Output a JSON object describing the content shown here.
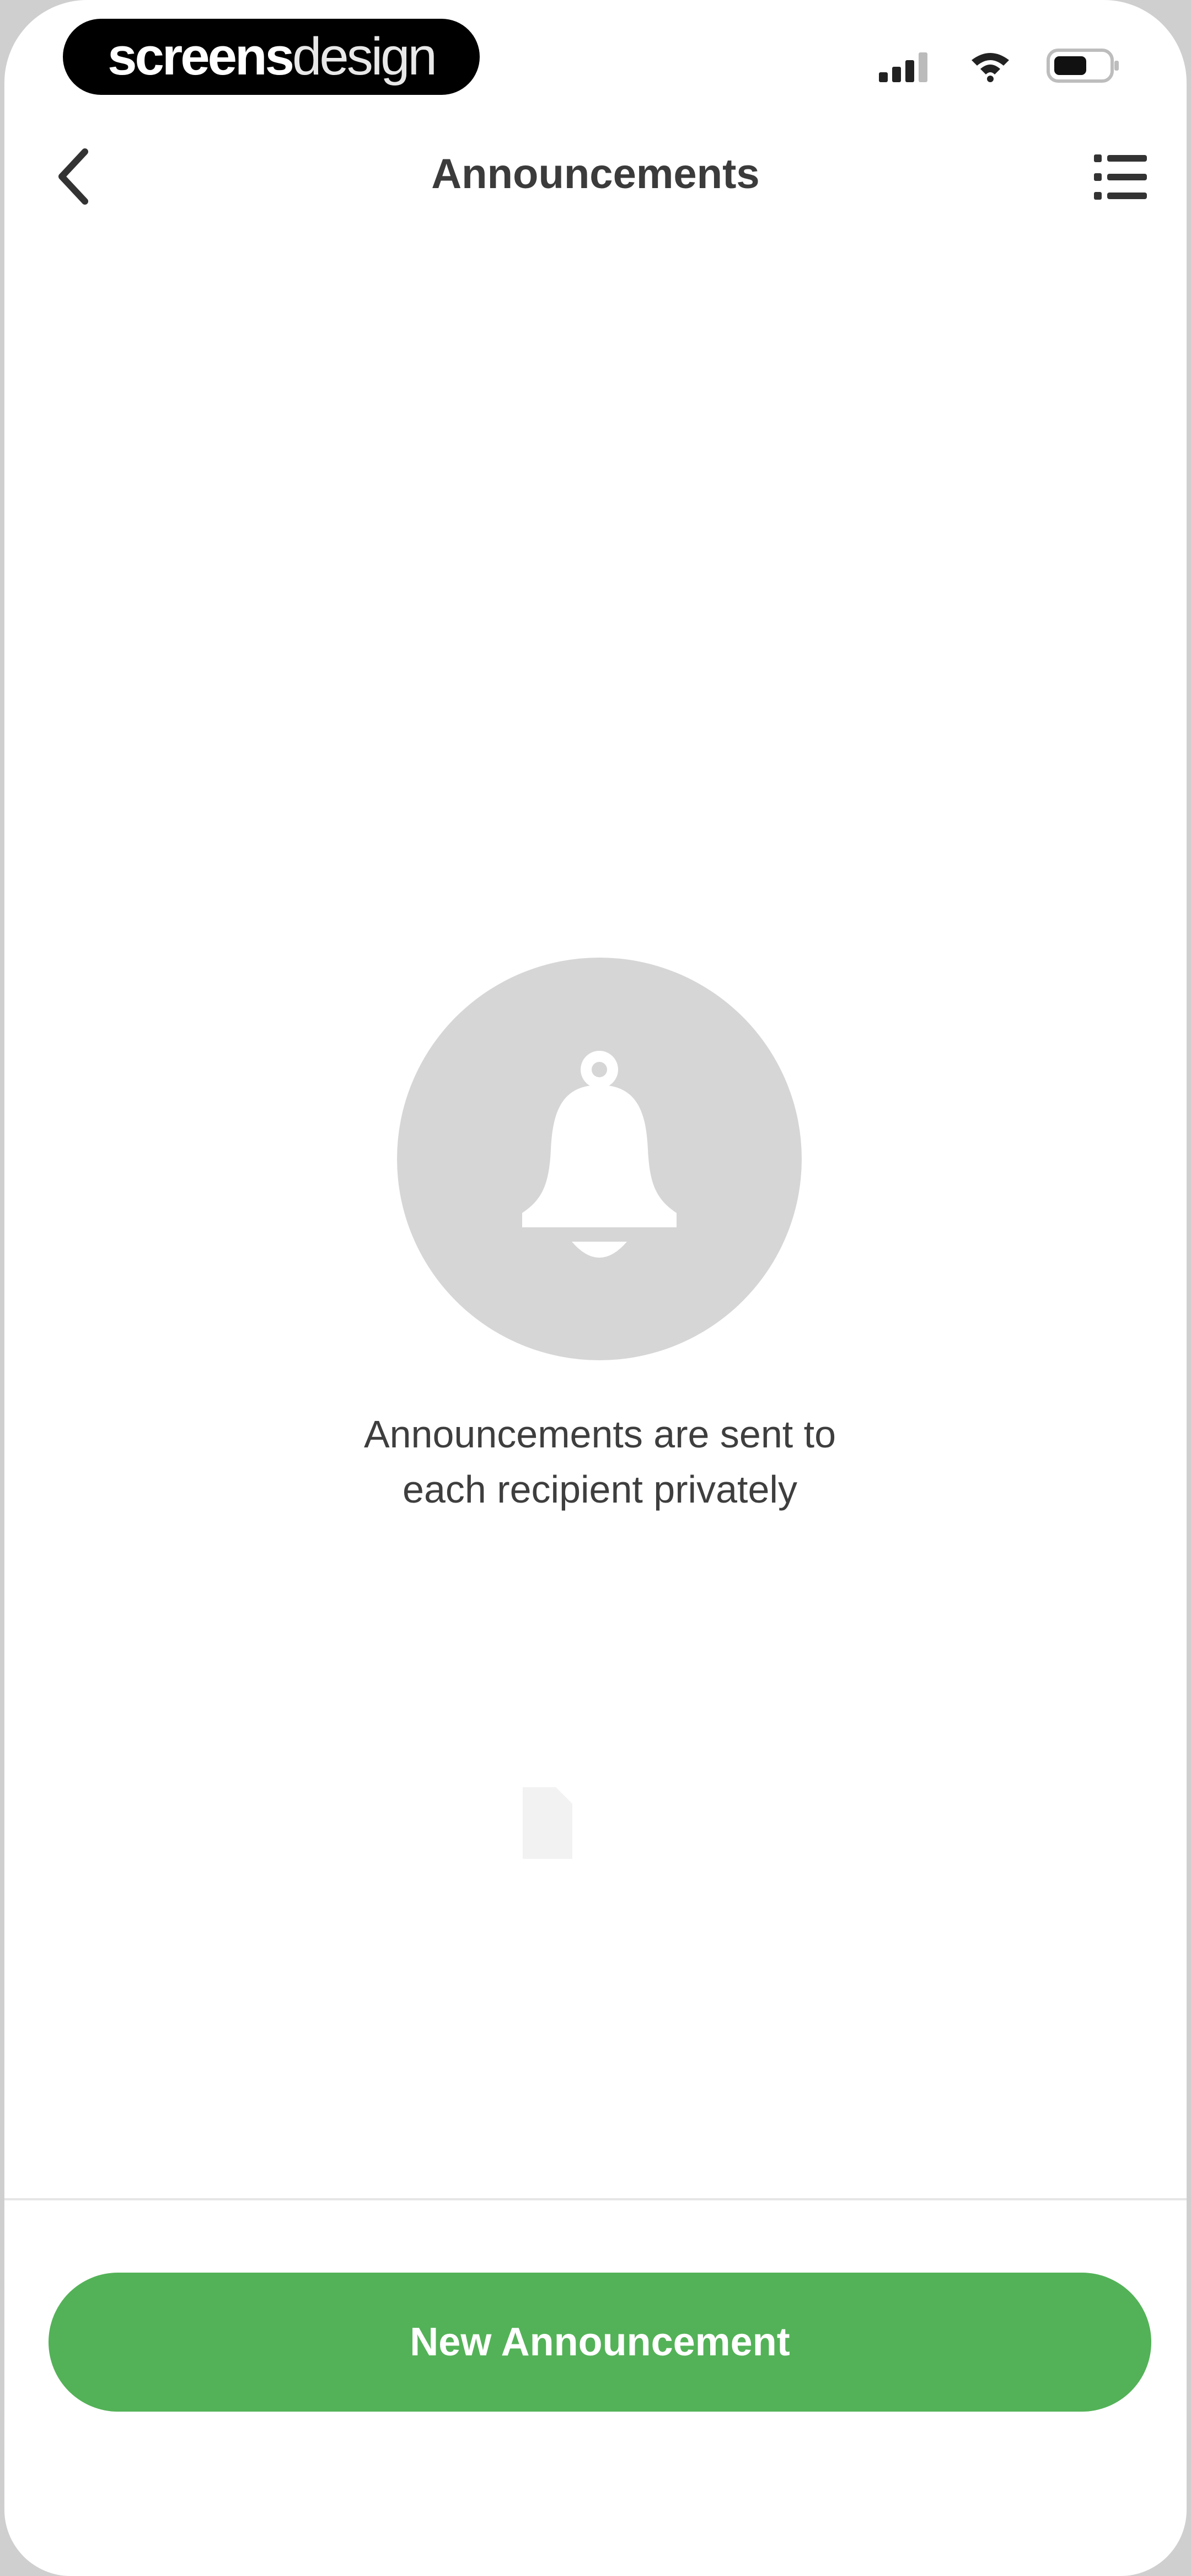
{
  "brand": {
    "part1": "screens",
    "part2": "design"
  },
  "status_bar": {
    "signal_icon": "signal-icon",
    "wifi_icon": "wifi-icon",
    "battery_icon": "battery-icon"
  },
  "nav": {
    "title": "Announcements",
    "back_icon": "back-chevron-icon",
    "menu_icon": "list-menu-icon"
  },
  "empty_state": {
    "icon": "bell-icon",
    "line1": "Announcements are sent to",
    "line2": "each recipient privately"
  },
  "actions": {
    "new_announcement_label": "New Announcement"
  },
  "colors": {
    "accent_green": "#53b257",
    "icon_circle": "#d6d6d6",
    "title_text": "#3b3b3b"
  }
}
